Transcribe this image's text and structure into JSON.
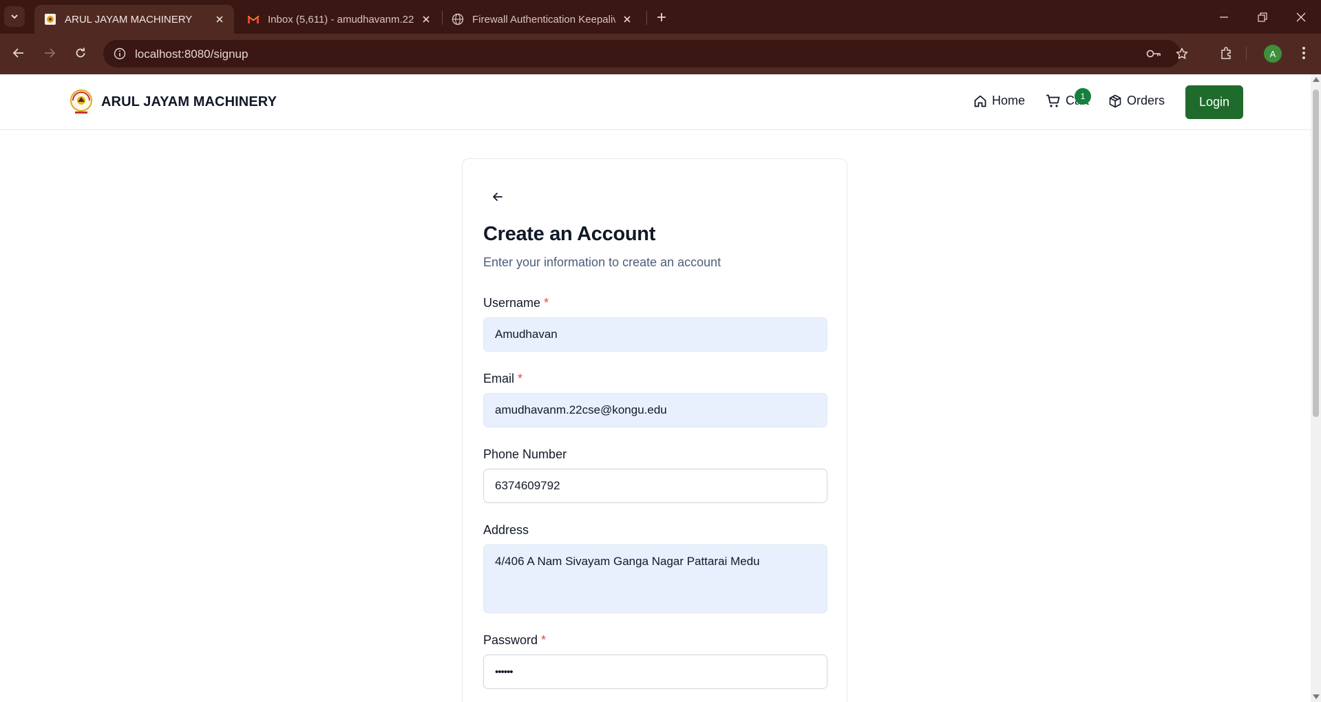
{
  "browser": {
    "tabs": [
      {
        "title": "ARUL JAYAM MACHINERY",
        "active": true
      },
      {
        "title": "Inbox (5,611) - amudhavanm.22",
        "active": false
      },
      {
        "title": "Firewall Authentication Keepaliv",
        "active": false
      }
    ],
    "url": "localhost:8080/signup",
    "profile_initial": "A"
  },
  "header": {
    "brand_name": "ARUL JAYAM MACHINERY",
    "nav": {
      "home": "Home",
      "cart": "Cart",
      "cart_count": "1",
      "orders": "Orders",
      "login": "Login"
    }
  },
  "form": {
    "title": "Create an Account",
    "subtitle": "Enter your information to create an account",
    "username": {
      "label": "Username",
      "required": "*",
      "value": "Amudhavan"
    },
    "email": {
      "label": "Email",
      "required": "*",
      "value": "amudhavanm.22cse@kongu.edu"
    },
    "phone": {
      "label": "Phone Number",
      "value": "6374609792"
    },
    "address": {
      "label": "Address",
      "value": "4/406 A Nam Sivayam Ganga Nagar Pattarai Medu"
    },
    "password": {
      "label": "Password",
      "required": "*",
      "value": "••••••"
    }
  },
  "colors": {
    "tabstrip": "#3a1712",
    "toolbar": "#502a22",
    "accent_green": "#1f6b2c",
    "autofill_bg": "#e8f0fe",
    "required": "#ef4444"
  }
}
